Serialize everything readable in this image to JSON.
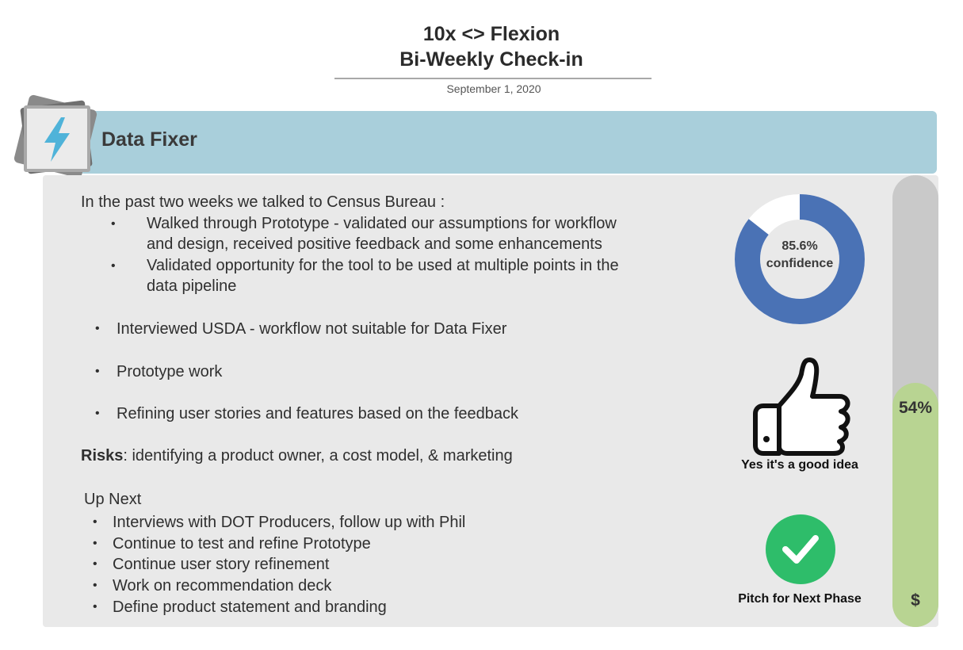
{
  "header": {
    "title_line1": "10x <> Flexion",
    "title_line2": "Bi-Weekly Check-in",
    "date": "September 1, 2020"
  },
  "project": {
    "title": "Data Fixer",
    "icon": "lightning-bolt-icon",
    "accent_color": "#a9cfdb"
  },
  "summary": {
    "intro": "In the past two weeks we talked to Census Bureau :",
    "census_items": [
      {
        "line1": "Walked through Prototype - validated our assumptions for workflow",
        "line2": "and design, received positive feedback and some enhancements"
      },
      {
        "line1": "Validated opportunity for the tool to be used at multiple points in the",
        "line2": "data pipeline"
      }
    ],
    "items": [
      "Interviewed USDA - workflow not suitable for Data Fixer",
      "Prototype work",
      "Refining user stories and features based on the feedback"
    ],
    "risks_label": "Risks",
    "risks_text": ": identifying a product owner, a cost model, & marketing"
  },
  "up_next": {
    "heading": "Up Next",
    "items": [
      "Interviews with DOT Producers, follow up with Phil",
      "Continue to test and refine Prototype",
      "Continue user story refinement",
      "Work on recommendation deck",
      "Define product statement and branding"
    ]
  },
  "confidence": {
    "value": 85.6,
    "value_text": "85.6%",
    "label": "confidence",
    "color": "#4a72b5"
  },
  "assessment": {
    "icon": "thumbs-up-icon",
    "label": "Yes it's a good idea"
  },
  "next_phase": {
    "icon": "checkmark-icon",
    "label": "Pitch for Next Phase",
    "color": "#2ebd6a"
  },
  "budget": {
    "percent": 54,
    "percent_text": "54%",
    "symbol": "$",
    "fill_color": "#b8d492"
  }
}
